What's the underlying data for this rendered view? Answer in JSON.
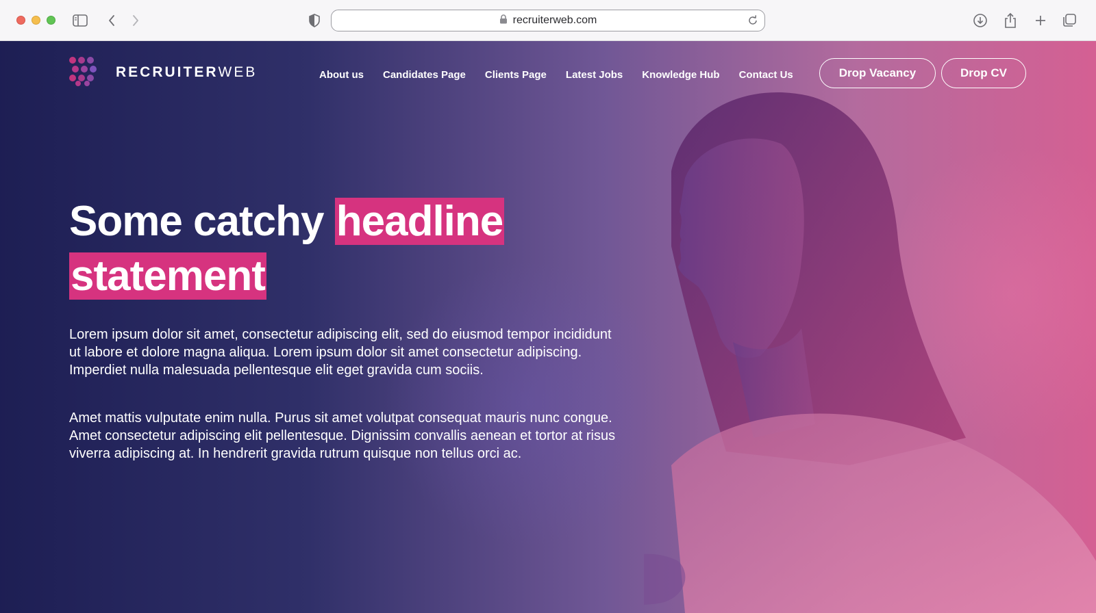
{
  "browser": {
    "url": "recruiterweb.com",
    "icons": [
      "sidebar-icon",
      "back-icon",
      "forward-icon",
      "shield-icon",
      "lock-icon",
      "reload-icon",
      "download-icon",
      "share-icon",
      "new-tab-icon",
      "tabs-overview-icon"
    ]
  },
  "site": {
    "brand_bold": "RECRUITER",
    "brand_light": "WEB",
    "logo_icon": "dot-grid-logo",
    "colors": {
      "accent": "#d6337f",
      "navy": "#16174e",
      "text": "#ffffff"
    }
  },
  "nav": {
    "items": [
      {
        "label": "About us"
      },
      {
        "label": "Candidates Page"
      },
      {
        "label": "Clients Page"
      },
      {
        "label": "Latest Jobs"
      },
      {
        "label": "Knowledge Hub"
      },
      {
        "label": "Contact Us"
      }
    ],
    "cta_vacancy": "Drop Vacancy",
    "cta_cv": "Drop CV"
  },
  "hero": {
    "headline_part1": "Some catchy ",
    "headline_highlight1": "headline",
    "headline_highlight2": "statement",
    "paragraph1": "Lorem ipsum dolor sit amet, consectetur adipiscing elit, sed do eiusmod tempor incididunt ut labore et dolore magna aliqua. Lorem ipsum dolor sit amet consectetur adipiscing. Imperdiet nulla malesuada pellentesque elit eget gravida cum sociis.",
    "paragraph2": "Amet mattis vulputate enim nulla. Purus sit amet volutpat consequat mauris nunc congue. Amet consectetur adipiscing elit pellentesque. Dignissim convallis aenean et tortor at risus viverra adipiscing at. In hendrerit gravida rutrum quisque non tellus orci ac."
  }
}
